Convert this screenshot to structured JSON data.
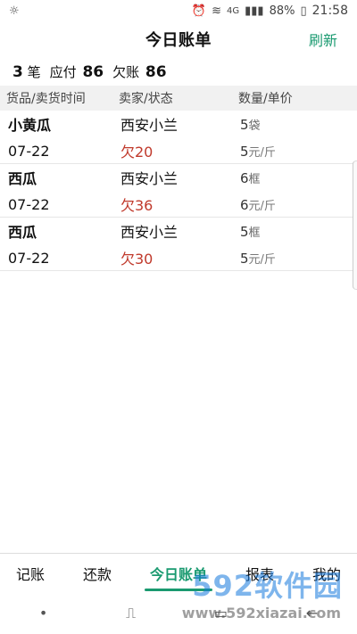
{
  "status_bar": {
    "network": "4G",
    "battery_percent": "88%",
    "time": "21:58"
  },
  "header": {
    "title": "今日账单",
    "refresh_label": "刷新"
  },
  "summary": {
    "count": "3",
    "count_unit": "笔",
    "payable_label": "应付",
    "payable_value": "86",
    "debt_label": "欠账",
    "debt_value": "86"
  },
  "columns": {
    "goods_time": "货品/卖货时间",
    "seller_status": "卖家/状态",
    "qty_price": "数量/单价"
  },
  "rows": [
    {
      "goods": "小黄瓜",
      "date": "07-22",
      "seller": "西安小兰",
      "status": "欠20",
      "qty": "5",
      "qty_unit": "袋",
      "price": "5",
      "price_unit": "元/斤"
    },
    {
      "goods": "西瓜",
      "date": "07-22",
      "seller": "西安小兰",
      "status": "欠36",
      "qty": "6",
      "qty_unit": "框",
      "price": "6",
      "price_unit": "元/斤"
    },
    {
      "goods": "西瓜",
      "date": "07-22",
      "seller": "西安小兰",
      "status": "欠30",
      "qty": "5",
      "qty_unit": "框",
      "price": "5",
      "price_unit": "元/斤"
    }
  ],
  "tabs": [
    "记账",
    "还款",
    "今日账单",
    "报表",
    "我的"
  ],
  "active_tab_index": 2,
  "watermark": {
    "main": "592软件园",
    "url": "www.592xiazai.com"
  },
  "colors": {
    "accent": "#1a9a70",
    "debt": "#c0392b"
  }
}
